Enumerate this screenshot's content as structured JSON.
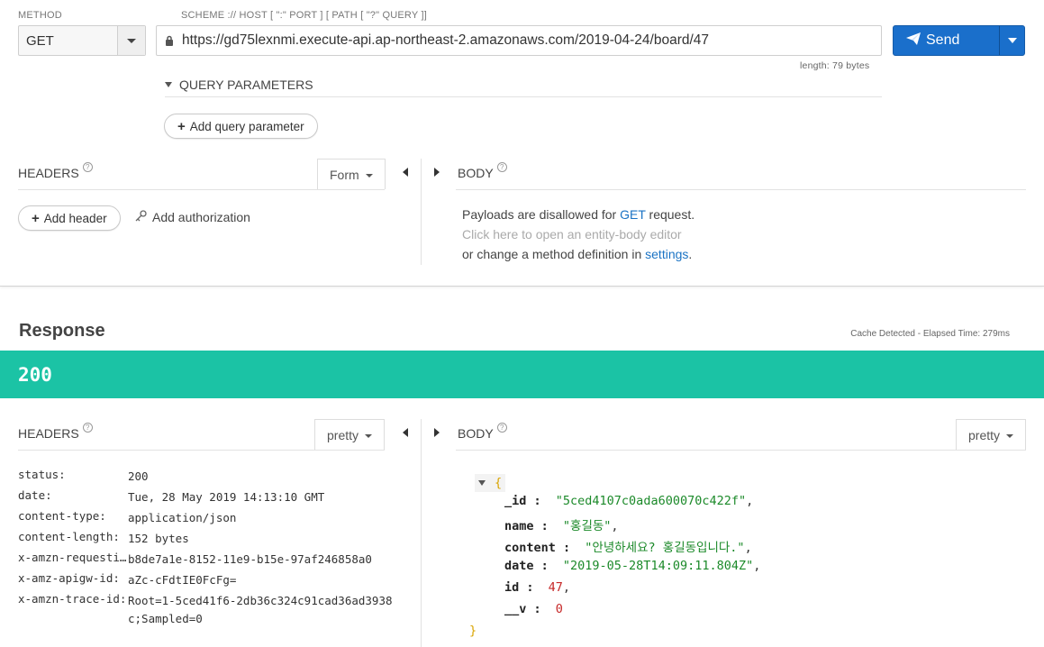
{
  "request": {
    "method_label": "METHOD",
    "method_value": "GET",
    "url_label": "SCHEME :// HOST [ \":\" PORT ] [ PATH [ \"?\" QUERY ]]",
    "url_value": "https://gd75lexnmi.execute-api.ap-northeast-2.amazonaws.com/2019-04-24/board/47",
    "length_text": "length: 79 bytes",
    "send_label": "Send",
    "query_params_label": "QUERY PARAMETERS",
    "add_query_label": "Add query parameter",
    "headers_label": "HEADERS",
    "headers_mode": "Form",
    "add_header_label": "Add header",
    "add_auth_label": "Add authorization",
    "body_label": "BODY",
    "body_msg": {
      "line1_pre": "Payloads are disallowed for ",
      "line1_link": "GET",
      "line1_post": " request.",
      "line2": "Click here to open an entity-body editor",
      "line3_pre": "or change a method definition in ",
      "line3_link": "settings",
      "line3_post": "."
    }
  },
  "response": {
    "title": "Response",
    "cache_text": "Cache Detected - Elapsed Time: 279ms",
    "status_code": "200",
    "status_color": "#1bc3a5",
    "headers_label": "HEADERS",
    "headers_mode": "pretty",
    "body_label": "BODY",
    "body_mode": "pretty",
    "headers": [
      {
        "key": "status:",
        "value": "200"
      },
      {
        "key": "date:",
        "value": "Tue, 28 May 2019 14:13:10 GMT"
      },
      {
        "key": "content-type:",
        "value": "application/json"
      },
      {
        "key": "content-length:",
        "value": "152 bytes"
      },
      {
        "key": "x-amzn-requesti…",
        "value": "b8de7a1e-8152-11e9-b15e-97af246858a0"
      },
      {
        "key": "x-amz-apigw-id:",
        "value": "aZc-cFdtIE0FcFg="
      },
      {
        "key": "x-amzn-trace-id:",
        "value": "Root=1-5ced41f6-2db36c324c91cad36ad3938c;Sampled=0"
      }
    ],
    "json_body": {
      "open": "{",
      "close": "}",
      "fields": [
        {
          "key": "_id",
          "value": "\"5ced4107c0ada600070c422f\"",
          "type": "str"
        },
        {
          "key": "name",
          "value": "\"홍길동\"",
          "type": "str"
        },
        {
          "key": "content",
          "value": "\"안녕하세요? 홍길동입니다.\"",
          "type": "str"
        },
        {
          "key": "date",
          "value": "\"2019-05-28T14:09:11.804Z\"",
          "type": "str"
        },
        {
          "key": "id",
          "value": "47",
          "type": "num"
        },
        {
          "key": "__v",
          "value": "0",
          "type": "num"
        }
      ]
    }
  }
}
